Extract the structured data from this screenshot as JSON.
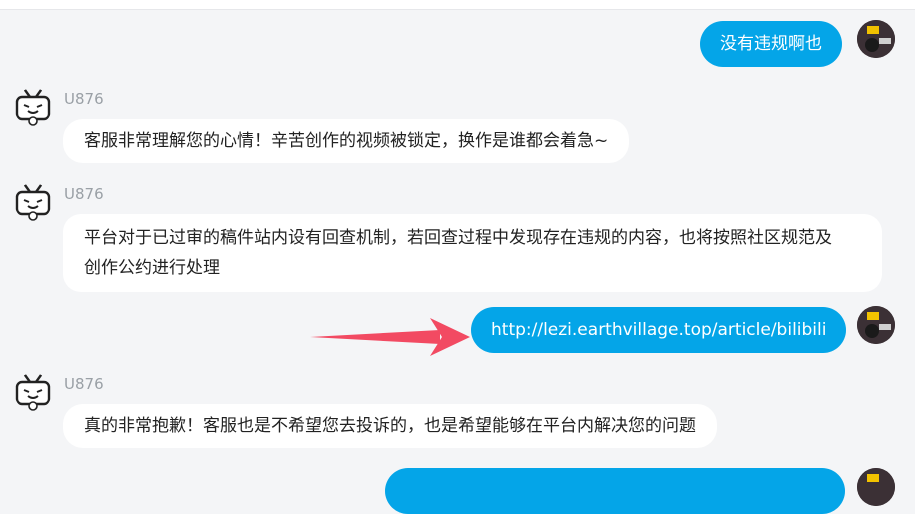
{
  "messages": [
    {
      "side": "right",
      "text": "没有违规啊也"
    },
    {
      "side": "left",
      "name": "U876",
      "text": "客服非常理解您的心情！辛苦创作的视频被锁定，换作是谁都会着急~"
    },
    {
      "side": "left",
      "name": "U876",
      "lines": [
        "平台对于已过审的稿件站内设有回查机制，若回查过程中发现存在违规的内容，也将按照社区规范及",
        "创作公约进行处理"
      ]
    },
    {
      "side": "right",
      "text": "http://lezi.earthvillage.top/article/bilibili"
    },
    {
      "side": "left",
      "name": "U876",
      "text": "真的非常抱歉！客服也是不希望您去投诉的，也是希望能够在平台内解决您的问题"
    },
    {
      "side": "right",
      "text": ""
    }
  ],
  "annotation": {
    "type": "arrow",
    "color": "#f24a62"
  },
  "colors": {
    "user_bubble": "#04a5e8",
    "bot_bubble": "#ffffff",
    "background": "#f4f5f7"
  }
}
